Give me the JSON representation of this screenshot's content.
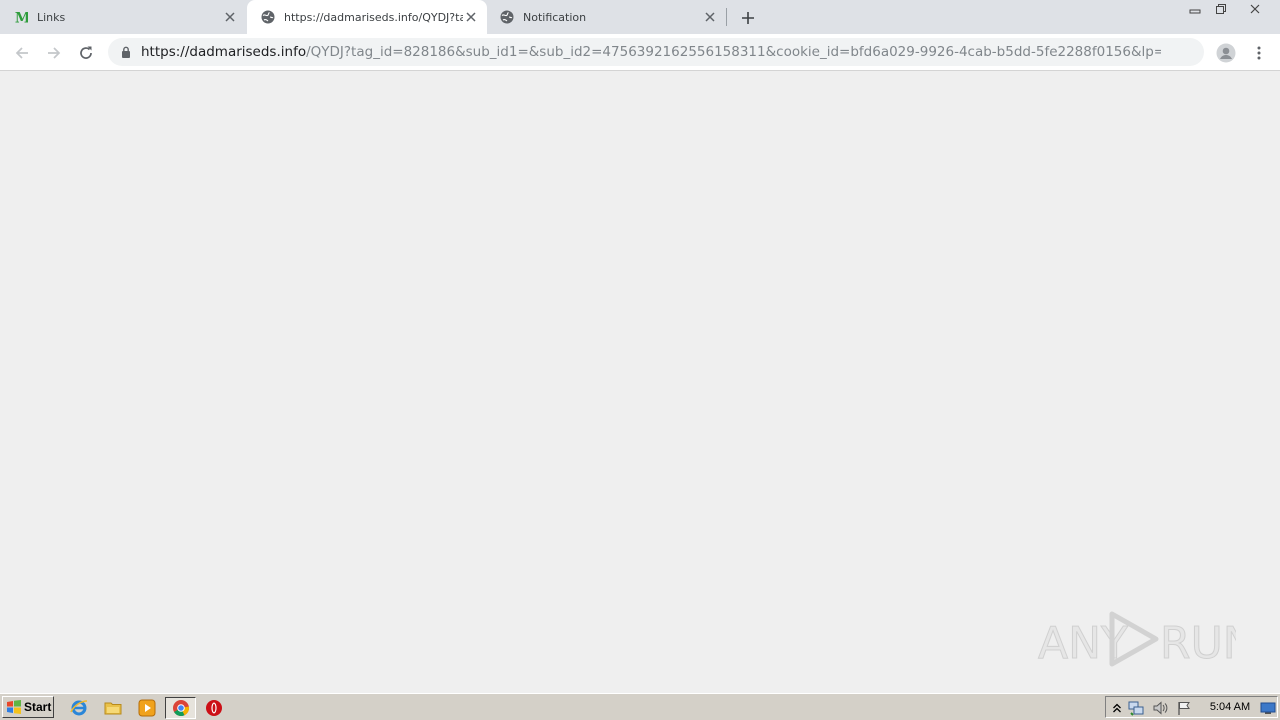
{
  "browser": {
    "tabs": [
      {
        "title": "Links",
        "favicon": "m-logo-icon",
        "active": false
      },
      {
        "title": "https://dadmariseds.info/QYDJ?tag_",
        "favicon": "globe-icon",
        "active": true
      },
      {
        "title": "Notification",
        "favicon": "globe-icon",
        "active": false
      }
    ],
    "address": {
      "host": "https://dadmariseds.info",
      "rest": "/QYDJ?tag_id=828186&sub_id1=&sub_id2=4756392162556158311&cookie_id=bfd6a029-9926-4cab-b5dd-5fe2288f0156&lp=animateLo..."
    }
  },
  "watermark": {
    "left": "ANY",
    "right": "RUN"
  },
  "taskbar": {
    "start_label": "Start",
    "clock": "5:04 AM"
  },
  "colors": {
    "tabstrip": "#dee1e6",
    "content_bg": "#efefef",
    "taskbar": "#d4d0c8",
    "m_logo": "#2e9c3c",
    "opera_red": "#cc0f16"
  }
}
